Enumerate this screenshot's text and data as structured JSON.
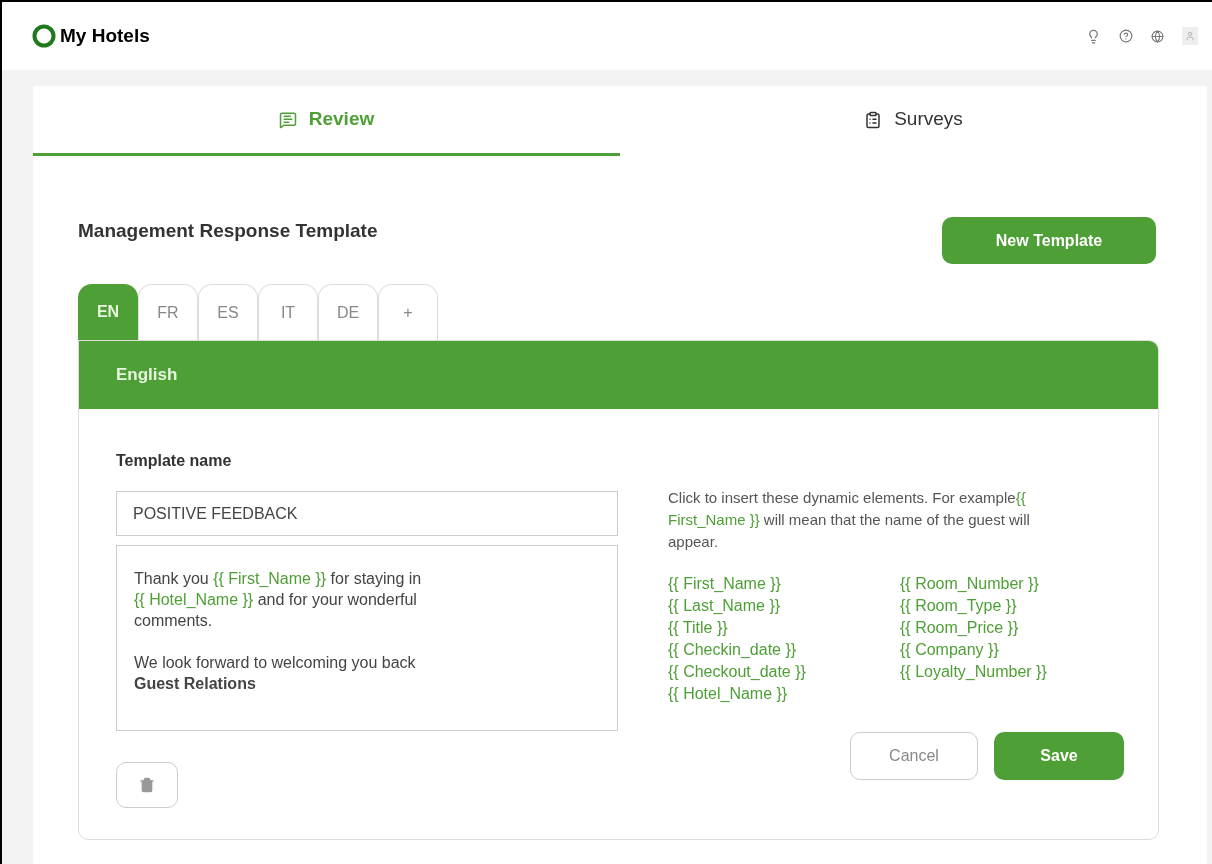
{
  "app": {
    "title": "My Hotels"
  },
  "main_tabs": [
    {
      "label": "Review",
      "selected": true,
      "kind": "review"
    },
    {
      "label": "Surveys",
      "selected": false,
      "kind": "surveys"
    }
  ],
  "heading": "Management Response Template",
  "new_button": "New Template",
  "language_tabs": [
    {
      "label": "EN",
      "selected": true
    },
    {
      "label": "FR",
      "selected": false
    },
    {
      "label": "ES",
      "selected": false
    },
    {
      "label": "IT",
      "selected": false
    },
    {
      "label": "DE",
      "selected": false
    },
    {
      "label": "+",
      "selected": false
    }
  ],
  "panel_title": "English",
  "template_name_label": "Template name",
  "template_name_value": "POSITIVE FEEDBACK",
  "message": [
    [
      [
        {
          "kind": "text",
          "text": "Thank you "
        },
        {
          "kind": "token",
          "text": "{{ First_Name }}"
        },
        {
          "kind": "text",
          "text": " for staying in"
        }
      ],
      [
        {
          "kind": "token",
          "text": "{{ Hotel_Name }}"
        },
        {
          "kind": "text",
          "text": " and for your wonderful"
        }
      ],
      [
        {
          "kind": "text",
          "text": "comments."
        }
      ]
    ],
    [
      [
        {
          "kind": "text",
          "text": "We look forward to welcoming you back"
        }
      ],
      [
        {
          "kind": "bold",
          "text": "Guest Relations"
        }
      ]
    ]
  ],
  "help": [
    {
      "kind": "text",
      "text": "Click to insert these dynamic elements. For example"
    },
    {
      "kind": "token",
      "text": "{{ First_Name }}"
    },
    {
      "kind": "text",
      "text": " will mean that the name of the guest will appear."
    }
  ],
  "tokens_left": [
    "{{ First_Name }}",
    "{{ Last_Name }}",
    "{{ Title }}",
    "{{ Checkin_date }}",
    "{{ Checkout_date }}",
    "{{ Hotel_Name }}"
  ],
  "tokens_right": [
    "{{ Room_Number }}",
    "{{ Room_Type }}",
    "{{ Room_Price }}",
    "{{ Company }}",
    "{{ Loyalty_Number }}"
  ],
  "cancel_button": "Cancel",
  "save_button": "Save"
}
